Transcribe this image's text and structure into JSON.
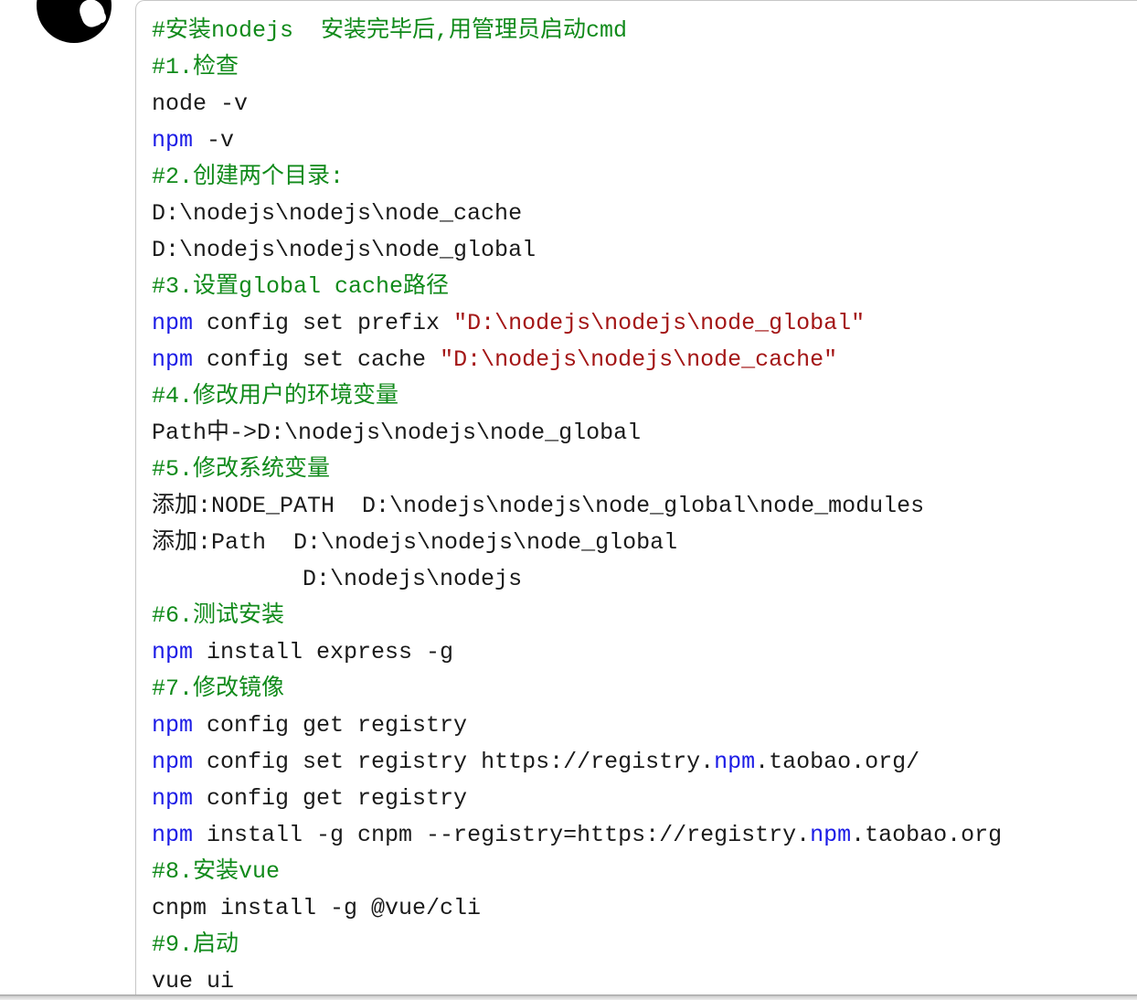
{
  "code": {
    "lines": [
      {
        "segments": [
          {
            "t": "#安装nodejs  安装完毕后,用管理员启动cmd",
            "c": "comment"
          }
        ]
      },
      {
        "segments": [
          {
            "t": "#1.检查",
            "c": "comment"
          }
        ]
      },
      {
        "segments": [
          {
            "t": "node -v",
            "c": "plain"
          }
        ]
      },
      {
        "segments": [
          {
            "t": "npm",
            "c": "kw"
          },
          {
            "t": " -v",
            "c": "plain"
          }
        ]
      },
      {
        "segments": [
          {
            "t": "#2.创建两个目录:",
            "c": "comment"
          }
        ]
      },
      {
        "segments": [
          {
            "t": "D:\\nodejs\\nodejs\\node_cache",
            "c": "plain"
          }
        ]
      },
      {
        "segments": [
          {
            "t": "D:\\nodejs\\nodejs\\node_global",
            "c": "plain"
          }
        ]
      },
      {
        "segments": [
          {
            "t": "#3.设置global cache路径",
            "c": "comment"
          }
        ]
      },
      {
        "segments": [
          {
            "t": "npm",
            "c": "kw"
          },
          {
            "t": " config set prefix ",
            "c": "plain"
          },
          {
            "t": "\"D:\\nodejs\\nodejs\\node_global\"",
            "c": "str"
          }
        ]
      },
      {
        "segments": [
          {
            "t": "npm",
            "c": "kw"
          },
          {
            "t": " config set cache ",
            "c": "plain"
          },
          {
            "t": "\"D:\\nodejs\\nodejs\\node_cache\"",
            "c": "str"
          }
        ]
      },
      {
        "segments": [
          {
            "t": "#4.修改用户的环境变量",
            "c": "comment"
          }
        ]
      },
      {
        "segments": [
          {
            "t": "Path中->D:\\nodejs\\nodejs\\node_global",
            "c": "plain"
          }
        ]
      },
      {
        "segments": [
          {
            "t": "#5.修改系统变量",
            "c": "comment"
          }
        ]
      },
      {
        "segments": [
          {
            "t": "添加:NODE_PATH  D:\\nodejs\\nodejs\\node_global\\node_modules",
            "c": "plain"
          }
        ]
      },
      {
        "segments": [
          {
            "t": "添加:Path  D:\\nodejs\\nodejs\\node_global",
            "c": "plain"
          }
        ]
      },
      {
        "segments": [
          {
            "t": "           D:\\nodejs\\nodejs",
            "c": "plain"
          }
        ]
      },
      {
        "segments": [
          {
            "t": "#6.测试安装",
            "c": "comment"
          }
        ]
      },
      {
        "segments": [
          {
            "t": "npm",
            "c": "kw"
          },
          {
            "t": " install express -g",
            "c": "plain"
          }
        ]
      },
      {
        "segments": [
          {
            "t": "#7.修改镜像",
            "c": "comment"
          }
        ]
      },
      {
        "segments": [
          {
            "t": "npm",
            "c": "kw"
          },
          {
            "t": " config get registry",
            "c": "plain"
          }
        ]
      },
      {
        "segments": [
          {
            "t": "npm",
            "c": "kw"
          },
          {
            "t": " config set registry https://registry.",
            "c": "plain"
          },
          {
            "t": "npm",
            "c": "kw"
          },
          {
            "t": ".taobao.org/",
            "c": "plain"
          }
        ]
      },
      {
        "segments": [
          {
            "t": "npm",
            "c": "kw"
          },
          {
            "t": " config get registry",
            "c": "plain"
          }
        ]
      },
      {
        "segments": [
          {
            "t": "npm",
            "c": "kw"
          },
          {
            "t": " install -g cnpm --registry=https://registry.",
            "c": "plain"
          },
          {
            "t": "npm",
            "c": "kw"
          },
          {
            "t": ".taobao.org",
            "c": "plain"
          }
        ]
      },
      {
        "segments": [
          {
            "t": "#8.安装vue",
            "c": "comment"
          }
        ]
      },
      {
        "segments": [
          {
            "t": "cnpm install -g @vue/cli",
            "c": "plain"
          }
        ]
      },
      {
        "segments": [
          {
            "t": "#9.启动",
            "c": "comment"
          }
        ]
      },
      {
        "segments": [
          {
            "t": "vue ui",
            "c": "plain"
          }
        ]
      }
    ]
  },
  "colors": {
    "comment": "#108a1a",
    "keyword": "#1c1ce6",
    "string": "#a31515",
    "text": "#1a1a1a"
  }
}
